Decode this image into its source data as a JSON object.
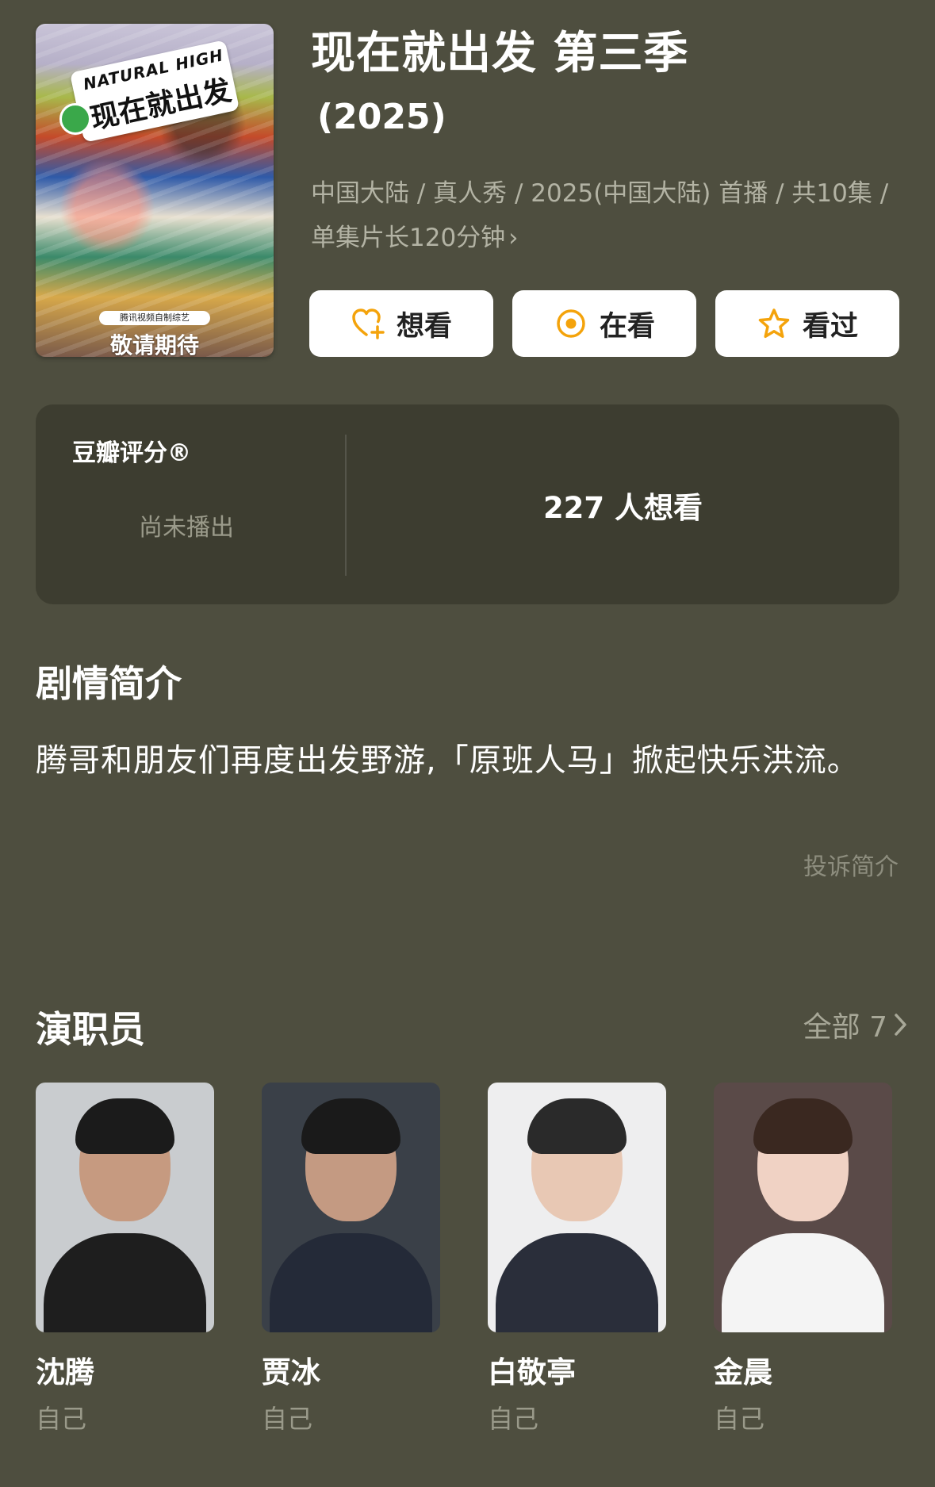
{
  "poster": {
    "logo_en": "NATURAL HIGH",
    "logo_cn": "现在就出发",
    "sub": "腾讯视频自制综艺",
    "tagline": "敬请期待"
  },
  "header": {
    "title": "现在就出发 第三季",
    "year": "(2025)",
    "meta_line": "中国大陆 / 真人秀 / 2025(中国大陆) 首播 / 共10集 / 单集片长120分钟",
    "meta_chevron": "›"
  },
  "actions": {
    "want_label": "想看",
    "watching_label": "在看",
    "watched_label": "看过",
    "icon_color": "#f4a30b"
  },
  "rating": {
    "label": "豆瓣评分®",
    "status": "尚未播出",
    "want_count": "227 人想看"
  },
  "synopsis": {
    "heading": "剧情简介",
    "text": "腾哥和朋友们再度出发野游,「原班人马」掀起快乐洪流。",
    "report_link": "投诉简介"
  },
  "cast": {
    "heading": "演职员",
    "see_all": "全部 7",
    "members": [
      {
        "name": "沈腾",
        "role": "自己",
        "bg": "#c9cccf",
        "skin": "#c69a80",
        "hair": "#1b1b1b",
        "cloth": "#1e1e1e"
      },
      {
        "name": "贾冰",
        "role": "自己",
        "bg": "#3a4048",
        "skin": "#c49a82",
        "hair": "#1a1a1a",
        "cloth": "#242a38"
      },
      {
        "name": "白敬亭",
        "role": "自己",
        "bg": "#eeeeef",
        "skin": "#e8c8b4",
        "hair": "#2a2a2a",
        "cloth": "#2a2e3a"
      },
      {
        "name": "金晨",
        "role": "自己",
        "bg": "#5a4a48",
        "skin": "#f0d2c4",
        "hair": "#3a2820",
        "cloth": "#f4f4f4"
      }
    ]
  }
}
